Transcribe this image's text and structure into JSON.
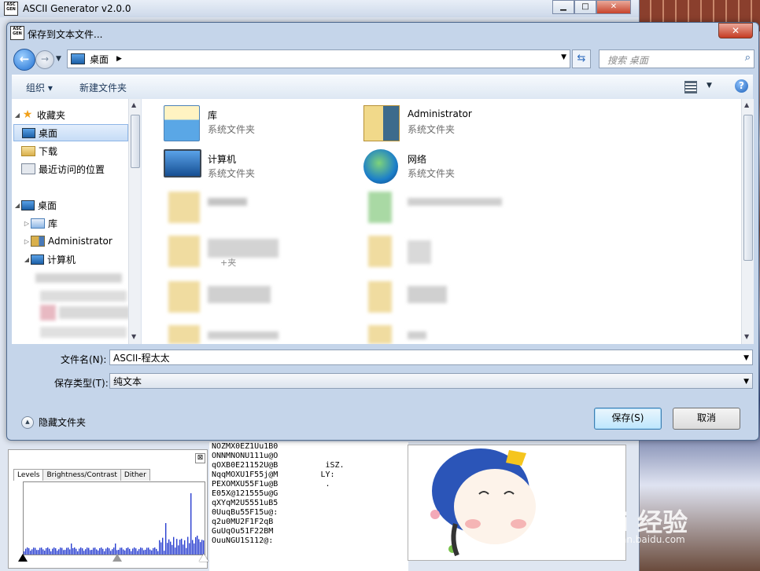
{
  "app": {
    "title": "ASCII Generator v2.0.0",
    "logo_text": "ASC GEN",
    "levels_panel": {
      "close_label": "⊠",
      "tabs": [
        "Levels",
        "Brightness/Contrast",
        "Dither"
      ]
    },
    "ascii_lines": [
      "NOZMX0EZ1Uu1B0",
      "ONNMNONU111u@O",
      "qOXB0E21152U@B          iSZ.",
      "NqqMOXU1F55j@M         LY:",
      "PEXOMXU55F1u@B          .",
      "E05X@121555u@G",
      "qXYqM2U5551uB5",
      "0UuqBu55F15u@:",
      "q2u0MU2F1F2qB",
      "GuUqOu51F22BM",
      "OuuNGU1S112@:"
    ]
  },
  "dialog": {
    "title": "保存到文本文件...",
    "close_label": "✕",
    "address": {
      "location": "桌面"
    },
    "search": {
      "placeholder": "搜索 桌面"
    },
    "toolbar": {
      "organize": "组织 ▾",
      "new_folder": "新建文件夹"
    },
    "tree": {
      "favorites": "收藏夹",
      "desktop_fav": "桌面",
      "downloads": "下载",
      "recent": "最近访问的位置",
      "desktop": "桌面",
      "library": "库",
      "admin": "Administrator",
      "computer": "计算机"
    },
    "files": [
      {
        "name": "库",
        "desc": "系统文件夹"
      },
      {
        "name": "Administrator",
        "desc": "系统文件夹"
      },
      {
        "name": "计算机",
        "desc": "系统文件夹"
      },
      {
        "name": "网络",
        "desc": "系统文件夹"
      }
    ],
    "filename_label": "文件名(N):",
    "filename_value": "ASCII-程太太",
    "filetype_label": "保存类型(T):",
    "filetype_value": "纯文本",
    "hide_folders": "隐藏文件夹",
    "save_button": "保存(S)",
    "cancel_button": "取消",
    "partial_text": "+夹"
  },
  "watermark": {
    "text": "Bai 经验",
    "sub": "jingyan.baidu.com"
  }
}
